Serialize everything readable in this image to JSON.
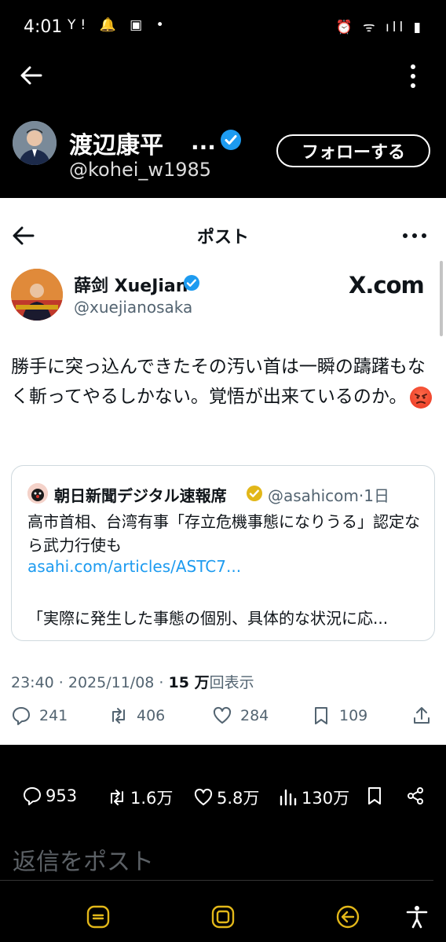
{
  "status_bar": {
    "time": "4:01",
    "left_icons": "Y! 🔔 ▣ •",
    "right_icons": "⏰ ᯤ ıll ▮"
  },
  "profile": {
    "name": "渡辺康平",
    "name_ellipsis": "...",
    "handle": "@kohei_w1985",
    "follow_label": "フォローする"
  },
  "card": {
    "title": "ポスト",
    "tweet": {
      "name": "薛剑 XueJian",
      "handle": "@xuejianosaka",
      "watermark": "X.com",
      "text": "勝手に突っ込んできたその汚い首は一瞬の躊躇もなく斬ってやるしかない。覚悟が出来ているのか。",
      "quote": {
        "name": "朝日新聞デジタル速報席",
        "handle": "@asahicom·1日",
        "text": "高市首相、台湾有事「存立危機事態になりうる」認定なら武力行使も",
        "link": "asahi.com/articles/ASTC7...",
        "text2": "「実際に発生した事態の個別、具体的な状況に応..."
      },
      "meta_time": "23:40 · 2025/11/08 · ",
      "meta_views": "15 万",
      "meta_views_label": "回表示",
      "stats": {
        "replies": "241",
        "reposts": "406",
        "likes": "284",
        "bookmarks": "109"
      }
    }
  },
  "bottom_stats": {
    "replies": "953",
    "reposts": "1.6万",
    "likes": "5.8万",
    "views": "130万"
  },
  "reply_placeholder": "返信をポスト",
  "colors": {
    "accent": "#1d9bf0",
    "gold": "#e2b719",
    "dark_bg": "#000000",
    "card_bg": "#ffffff"
  }
}
